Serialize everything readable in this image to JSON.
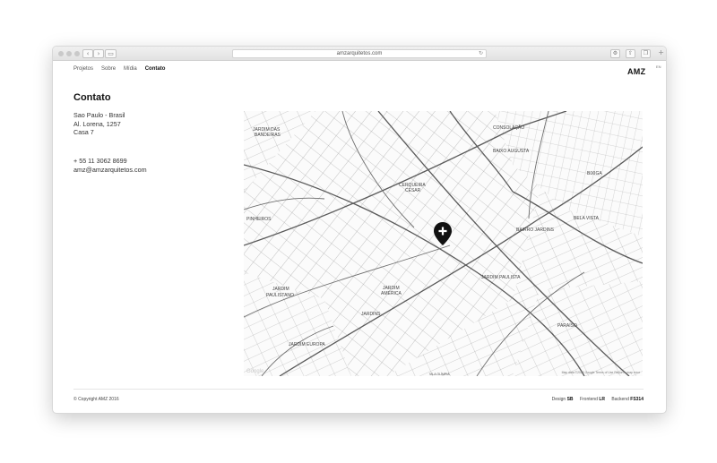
{
  "browser": {
    "url": "amzarquitetos.com",
    "back_icon": "chevron-left-icon",
    "forward_icon": "chevron-right-icon",
    "sidebar_icon": "sidebar-icon",
    "reload_icon": "reload-icon",
    "share_icon": "share-icon",
    "extensions": [
      "settings-icon",
      "share-icon",
      "tabs-icon"
    ]
  },
  "nav": {
    "items": [
      {
        "label": "Projetos"
      },
      {
        "label": "Sobre"
      },
      {
        "label": "Mídia"
      },
      {
        "label": "Contato",
        "active": true
      }
    ]
  },
  "brand": {
    "logo": "AMZ",
    "lang": "EN"
  },
  "contact": {
    "heading": "Contato",
    "address": [
      "Sao Paulo - Brasil",
      "Al. Lorena, 1257",
      "Casa 7"
    ],
    "phone": "+ 55 11 3062 8699",
    "email": "amz@amzarquitetos.com"
  },
  "map": {
    "labels": [
      {
        "text": "JARDIM DAS",
        "sub": "BANDEIRAS"
      },
      {
        "text": "CONSOLAÇÃO"
      },
      {
        "text": "BAIXO AUGUSTA"
      },
      {
        "text": "BIXIGA"
      },
      {
        "text": "CERQUEIRA",
        "sub": "CÉSAR"
      },
      {
        "text": "PINHEIROS"
      },
      {
        "text": "BAIRRO JARDINS"
      },
      {
        "text": "BELA VISTA"
      },
      {
        "text": "JARDIM PAULISTA"
      },
      {
        "text": "JARDIM",
        "sub": "PAULISTANO"
      },
      {
        "text": "JARDIM",
        "sub": "AMÉRICA"
      },
      {
        "text": "JARDINS"
      },
      {
        "text": "PARAÍSO"
      },
      {
        "text": "JARDIM EUROPA"
      },
      {
        "text": "VILA OLÍMPIA"
      }
    ],
    "attribution": "Map data ©2016 Google  Terms of Use  Report a map error",
    "google": "Google",
    "marker_icon": "map-pin-plus-icon"
  },
  "footer": {
    "copyright": "© Copyright AMZ 2016",
    "credits": [
      {
        "role": "Design",
        "who": "SB"
      },
      {
        "role": "Frontend",
        "who": "LR"
      },
      {
        "role": "Backend",
        "who": "FS314"
      }
    ]
  }
}
